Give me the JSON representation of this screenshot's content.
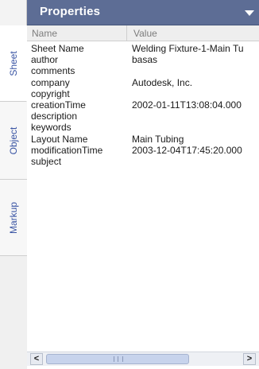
{
  "vertical_tabs": [
    {
      "label": "Sheet",
      "active": true
    },
    {
      "label": "Object",
      "active": false
    },
    {
      "label": "Markup",
      "active": false
    }
  ],
  "panel": {
    "title": "Properties",
    "menu_icon": "chevron-down-icon"
  },
  "columns": {
    "name": "Name",
    "value": "Value"
  },
  "rows": [
    {
      "name": "Sheet Name",
      "value": "Welding Fixture-1-Main Tu"
    },
    {
      "name": "author",
      "value": "basas"
    },
    {
      "name": "comments",
      "value": ""
    },
    {
      "name": "company",
      "value": "Autodesk, Inc."
    },
    {
      "name": "copyright",
      "value": ""
    },
    {
      "name": "creationTime",
      "value": "2002-01-11T13:08:04.000"
    },
    {
      "name": "description",
      "value": ""
    },
    {
      "name": "keywords",
      "value": ""
    },
    {
      "name": "Layout Name",
      "value": "Main Tubing"
    },
    {
      "name": "modificationTime",
      "value": "2003-12-04T17:45:20.000"
    },
    {
      "name": "subject",
      "value": ""
    }
  ],
  "scrollbar": {
    "left_arrow": "<",
    "right_arrow": ">"
  }
}
